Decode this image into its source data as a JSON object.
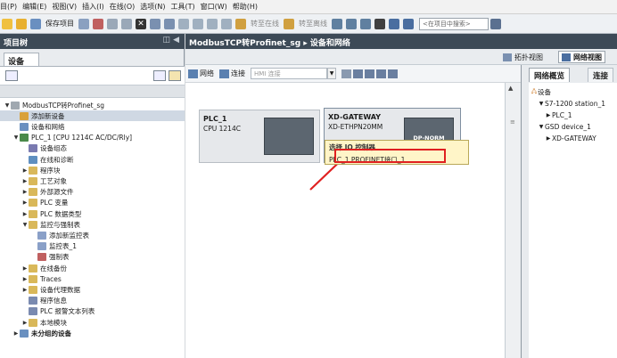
{
  "menu": {
    "items": [
      "目(P)",
      "编辑(E)",
      "视图(V)",
      "插入(I)",
      "在线(O)",
      "选项(N)",
      "工具(T)",
      "窗口(W)",
      "帮助(H)"
    ]
  },
  "toolbar": {
    "save_label": "保存项目",
    "go_online": "转至在线",
    "go_offline": "转至离线",
    "search_placeholder": "<在项目中搜索>"
  },
  "left": {
    "title": "项目树",
    "devices_tab": "设备",
    "tree": [
      {
        "label": "ModbusTCP转Profinet_sg",
        "indent": 0,
        "arrow": "▼",
        "icon": "project",
        "color": "#a0a8b0"
      },
      {
        "label": "添加新设备",
        "indent": 1,
        "arrow": "",
        "icon": "add-device",
        "color": "#d9a13a",
        "selected": true
      },
      {
        "label": "设备和网络",
        "indent": 1,
        "arrow": "",
        "icon": "network",
        "color": "#6a90c0"
      },
      {
        "label": "PLC_1 [CPU 1214C AC/DC/Rly]",
        "indent": 1,
        "arrow": "▼",
        "icon": "plc",
        "color": "#4a8a4a"
      },
      {
        "label": "设备组态",
        "indent": 2,
        "arrow": "",
        "icon": "config",
        "color": "#7a7ab0"
      },
      {
        "label": "在线和诊断",
        "indent": 2,
        "arrow": "",
        "icon": "diag",
        "color": "#5f8fc0"
      },
      {
        "label": "程序块",
        "indent": 2,
        "arrow": "▶",
        "icon": "folder",
        "color": "#d9b85a"
      },
      {
        "label": "工艺对象",
        "indent": 2,
        "arrow": "▶",
        "icon": "folder",
        "color": "#d9b85a"
      },
      {
        "label": "外部源文件",
        "indent": 2,
        "arrow": "▶",
        "icon": "folder",
        "color": "#d9b85a"
      },
      {
        "label": "PLC 变量",
        "indent": 2,
        "arrow": "▶",
        "icon": "folder",
        "color": "#d9b85a"
      },
      {
        "label": "PLC 数据类型",
        "indent": 2,
        "arrow": "▶",
        "icon": "folder",
        "color": "#d9b85a"
      },
      {
        "label": "监控与强制表",
        "indent": 2,
        "arrow": "▼",
        "icon": "folder",
        "color": "#d9b85a"
      },
      {
        "label": "添加新监控表",
        "indent": 3,
        "arrow": "",
        "icon": "add-table",
        "color": "#8aa0c8"
      },
      {
        "label": "监控表_1",
        "indent": 3,
        "arrow": "",
        "icon": "table",
        "color": "#8aa0c8"
      },
      {
        "label": "强制表",
        "indent": 3,
        "arrow": "",
        "icon": "table",
        "color": "#c06060"
      },
      {
        "label": "在线备份",
        "indent": 2,
        "arrow": "▶",
        "icon": "folder",
        "color": "#d9b85a"
      },
      {
        "label": "Traces",
        "indent": 2,
        "arrow": "▶",
        "icon": "folder",
        "color": "#d9b85a"
      },
      {
        "label": "设备代理数据",
        "indent": 2,
        "arrow": "▶",
        "icon": "folder",
        "color": "#d9b85a"
      },
      {
        "label": "程序信息",
        "indent": 2,
        "arrow": "",
        "icon": "info",
        "color": "#7a8ab0"
      },
      {
        "label": "PLC 报警文本列表",
        "indent": 2,
        "arrow": "",
        "icon": "alarm",
        "color": "#7a8ab0"
      },
      {
        "label": "本地模块",
        "indent": 2,
        "arrow": "▶",
        "icon": "folder",
        "color": "#d9b85a"
      },
      {
        "label": "未分组的设备",
        "indent": 1,
        "arrow": "▶",
        "icon": "devices",
        "color": "#6a90c0",
        "bold": true
      }
    ]
  },
  "center": {
    "title": "ModbusTCP转Profinet_sg  ▸  设备和网络",
    "views": [
      "拓扑视图",
      "网络视图"
    ],
    "net_toolbar": {
      "network": "网络",
      "connection": "连接",
      "hmi_placeholder": "HMI 连接"
    },
    "plc": {
      "name": "PLC_1",
      "type": "CPU 1214C"
    },
    "gateway": {
      "name": "XD-GATEWAY",
      "type": "XD-ETHPN20MM",
      "module_label": "DP-NORM",
      "link_text": "未分"
    },
    "tooltip": {
      "title": "选择 IO 控制器",
      "option": "PLC_1.PROFINET接口_1"
    }
  },
  "right": {
    "tabs": [
      "网络概览",
      "连接"
    ],
    "rows": [
      {
        "label": "设备",
        "indent": 0,
        "arrow": ""
      },
      {
        "label": "S7-1200 station_1",
        "indent": 1,
        "arrow": "▼"
      },
      {
        "label": "PLC_1",
        "indent": 2,
        "arrow": "▶"
      },
      {
        "label": "GSD device_1",
        "indent": 1,
        "arrow": "▼"
      },
      {
        "label": "XD-GATEWAY",
        "indent": 2,
        "arrow": "▶"
      }
    ]
  },
  "colors": {
    "title_bar": "#3d4a57",
    "tooltip_bg": "#fff5c8",
    "highlight_red": "#e02020",
    "port_green": "#3eb64a"
  }
}
